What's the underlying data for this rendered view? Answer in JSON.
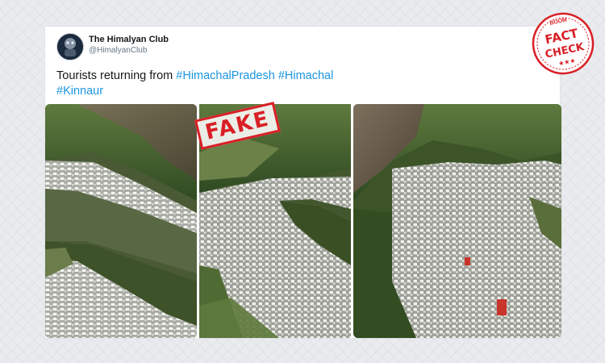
{
  "tweet": {
    "display_name": "The Himalyan Club",
    "handle": "@HimalyanClub",
    "more_menu": "···",
    "text_prefix": "Tourists returning from ",
    "hashtags": [
      "#HimachalPradesh",
      "#Himachal",
      "#Kinnaur"
    ],
    "image_count": 3
  },
  "overlays": {
    "fake_stamp": "FAKE",
    "fact_check_badge": {
      "brand": "BOOM",
      "line1": "FACT",
      "line2": "CHECK",
      "stars": "★★★"
    }
  },
  "colors": {
    "hashtag": "#1b95e0",
    "stamp_red": "#d91f26",
    "page_background": "#e9ebee"
  }
}
